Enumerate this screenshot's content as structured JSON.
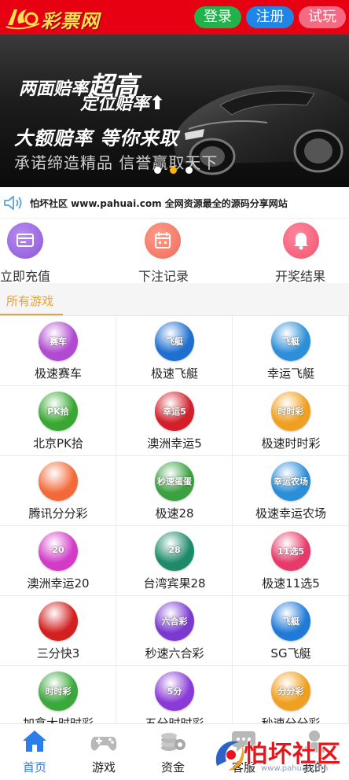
{
  "header": {
    "logo_text": "彩票网",
    "login_label": "登录",
    "register_label": "注册",
    "trial_label": "试玩",
    "bg_color": "#e60012"
  },
  "banner": {
    "line1_a": "两面赔率",
    "line1_b": "超高",
    "line2": "定位赔率",
    "line2_arrow": "⬆",
    "line3": "大额赔率 等你来取",
    "line4": "承诺缔造精品 信誉赢取天下",
    "slide_count": 3,
    "active_slide": 2
  },
  "notice": {
    "text": "怕坏社区 www.pahuai.com 全网资源最全的源码分享网站",
    "icon": "speaker-icon"
  },
  "quick_actions": [
    {
      "label": "立即充值",
      "icon": "card-icon",
      "color": "#9b6fe0"
    },
    {
      "label": "下注记录",
      "icon": "calendar-icon",
      "color": "#f47a6a"
    },
    {
      "label": "开奖结果",
      "icon": "bell-icon",
      "color": "#f5627a"
    }
  ],
  "section": {
    "title": "所有游戏"
  },
  "games": [
    {
      "name": "极速赛车",
      "tag": "赛车",
      "color": "#b04ad0"
    },
    {
      "name": "极速飞艇",
      "tag": "飞艇",
      "color": "#1f6fd0"
    },
    {
      "name": "幸运飞艇",
      "tag": "飞艇",
      "color": "#2c8fd8"
    },
    {
      "name": "北京PK拾",
      "tag": "PK拾",
      "color": "#38a832"
    },
    {
      "name": "澳洲幸运5",
      "tag": "幸运5",
      "color": "#d21f2a"
    },
    {
      "name": "极速时时彩",
      "tag": "时时彩",
      "color": "#f0a020"
    },
    {
      "name": "腾讯分分彩",
      "tag": "",
      "color": "#f26a3a"
    },
    {
      "name": "极速28",
      "tag": "秒速蛋蛋",
      "color": "#3aa040"
    },
    {
      "name": "极速幸运农场",
      "tag": "幸运农场",
      "color": "#2a8ed8"
    },
    {
      "name": "澳洲幸运20",
      "tag": "20",
      "color": "#d23ac8"
    },
    {
      "name": "台湾宾果28",
      "tag": "28",
      "color": "#1e8a6a"
    },
    {
      "name": "极速11选5",
      "tag": "11选5",
      "color": "#e83a6a"
    },
    {
      "name": "三分快3",
      "tag": "",
      "color": "#d21f1f"
    },
    {
      "name": "秒速六合彩",
      "tag": "六合彩",
      "color": "#7a3ad0"
    },
    {
      "name": "SG飞艇",
      "tag": "飞艇",
      "color": "#1f7ad8"
    },
    {
      "name": "加拿大时时彩",
      "tag": "时时彩",
      "color": "#3aa83a"
    },
    {
      "name": "五分时时彩",
      "tag": "5分",
      "color": "#8a3ad8"
    },
    {
      "name": "秒速分分彩",
      "tag": "分分彩",
      "color": "#f0a020"
    }
  ],
  "bottom_nav": [
    {
      "label": "首页",
      "icon": "home-icon",
      "active": true
    },
    {
      "label": "游戏",
      "icon": "gamepad-icon",
      "active": false
    },
    {
      "label": "资金",
      "icon": "coins-icon",
      "active": false
    },
    {
      "label": "客服",
      "icon": "chat-icon",
      "active": false
    },
    {
      "label": "我的",
      "icon": "user-icon",
      "active": false
    }
  ],
  "watermark": {
    "text": "怕坏社区",
    "url": "www.pahuai.com"
  },
  "colors": {
    "accent": "#e6a23c",
    "nav_active": "#2b7de9"
  }
}
